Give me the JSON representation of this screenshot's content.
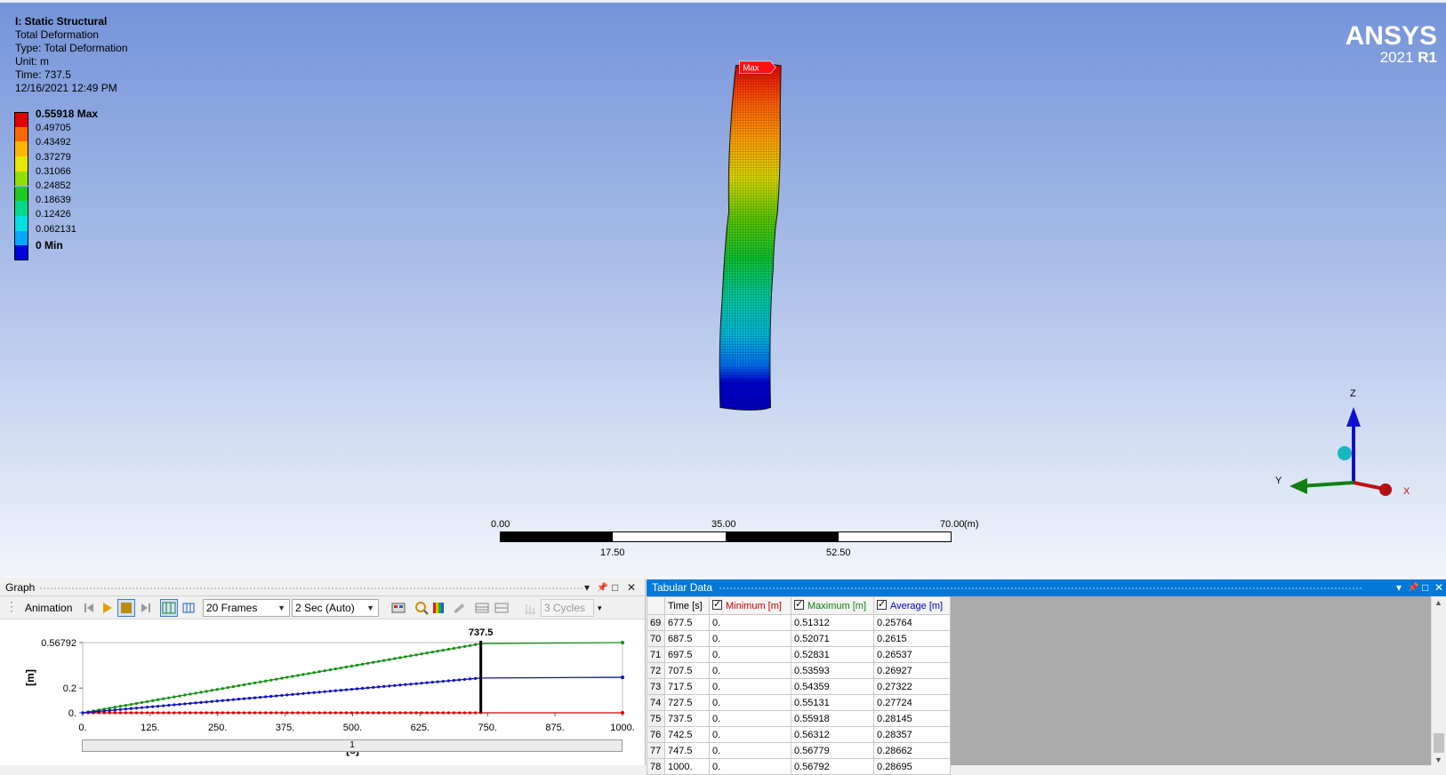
{
  "viewport": {
    "info": {
      "title": "I: Static Structural",
      "result_name": "Total Deformation",
      "type": "Type: Total Deformation",
      "unit": "Unit: m",
      "time": "Time: 737.5",
      "datetime": "12/16/2021 12:49 PM"
    },
    "legend": [
      {
        "label": "0.55918 Max",
        "color": "#e00000",
        "bold": true
      },
      {
        "label": "0.49705",
        "color": "#ff6a00"
      },
      {
        "label": "0.43492",
        "color": "#ffb400"
      },
      {
        "label": "0.37279",
        "color": "#e6e600"
      },
      {
        "label": "0.31066",
        "color": "#8fe000"
      },
      {
        "label": "0.24852",
        "color": "#1ecb1e"
      },
      {
        "label": "0.18639",
        "color": "#00d88a"
      },
      {
        "label": "0.12426",
        "color": "#00e0e0"
      },
      {
        "label": "0.062131",
        "color": "#00a8ff"
      },
      {
        "label": "0 Min",
        "color": "#0000e0",
        "bold": true
      }
    ],
    "logo": {
      "brand": "ANSYS",
      "version_year": "2021",
      "version_release": "R1"
    },
    "max_probe_label": "Max",
    "scale_bar": {
      "top_labels": [
        "0.00",
        "35.00",
        "70.00"
      ],
      "unit": "(m)",
      "bottom_labels": [
        "17.50",
        "52.50"
      ]
    },
    "triad": {
      "z": "Z",
      "y": "Y",
      "x": "X"
    }
  },
  "graph_panel": {
    "title": "Graph",
    "controls": {
      "pin": "📌",
      "restore": "□",
      "close": "✕",
      "menu": "▾"
    },
    "toolbar": {
      "animation_label": "Animation",
      "frames": "20 Frames",
      "duration": "2 Sec (Auto)",
      "cycles": "3 Cycles"
    },
    "slider_label": "1"
  },
  "chart_data": {
    "type": "line",
    "xlabel": "[s]",
    "ylabel": "[m]",
    "xlim": [
      0,
      1000
    ],
    "ylim": [
      0,
      0.56792
    ],
    "x_ticks": [
      "0.",
      "125.",
      "250.",
      "375.",
      "500.",
      "625.",
      "750.",
      "875.",
      "1000."
    ],
    "y_ticks": [
      "0.",
      "0.2",
      "0.56792"
    ],
    "cursor_label": "737.5",
    "cursor_x": 737.5,
    "series": [
      {
        "name": "Minimum [m]",
        "color": "#d00000",
        "x": [
          0,
          737.5,
          1000
        ],
        "values": [
          0,
          0,
          0
        ]
      },
      {
        "name": "Maximum [m]",
        "color": "#109010",
        "x": [
          0,
          737.5,
          1000
        ],
        "values": [
          0,
          0.55918,
          0.56792
        ]
      },
      {
        "name": "Average [m]",
        "color": "#1010c0",
        "x": [
          0,
          737.5,
          1000
        ],
        "values": [
          0,
          0.28145,
          0.28695
        ]
      }
    ]
  },
  "tabular_panel": {
    "title": "Tabular Data",
    "controls": {
      "pin": "📌",
      "restore": "□",
      "close": "✕",
      "menu": "▾"
    },
    "columns": [
      "Time [s]",
      "Minimum [m]",
      "Maximum [m]",
      "Average [m]"
    ],
    "column_colors": [
      "#000000",
      "#c00000",
      "#108010",
      "#0000c0"
    ],
    "rows": [
      [
        "69",
        "677.5",
        "0.",
        "0.51312",
        "0.25764"
      ],
      [
        "70",
        "687.5",
        "0.",
        "0.52071",
        "0.2615"
      ],
      [
        "71",
        "697.5",
        "0.",
        "0.52831",
        "0.26537"
      ],
      [
        "72",
        "707.5",
        "0.",
        "0.53593",
        "0.26927"
      ],
      [
        "73",
        "717.5",
        "0.",
        "0.54359",
        "0.27322"
      ],
      [
        "74",
        "727.5",
        "0.",
        "0.55131",
        "0.27724"
      ],
      [
        "75",
        "737.5",
        "0.",
        "0.55918",
        "0.28145"
      ],
      [
        "76",
        "742.5",
        "0.",
        "0.56312",
        "0.28357"
      ],
      [
        "77",
        "747.5",
        "0.",
        "0.56779",
        "0.28662"
      ],
      [
        "78",
        "1000.",
        "0.",
        "0.56792",
        "0.28695"
      ]
    ]
  }
}
